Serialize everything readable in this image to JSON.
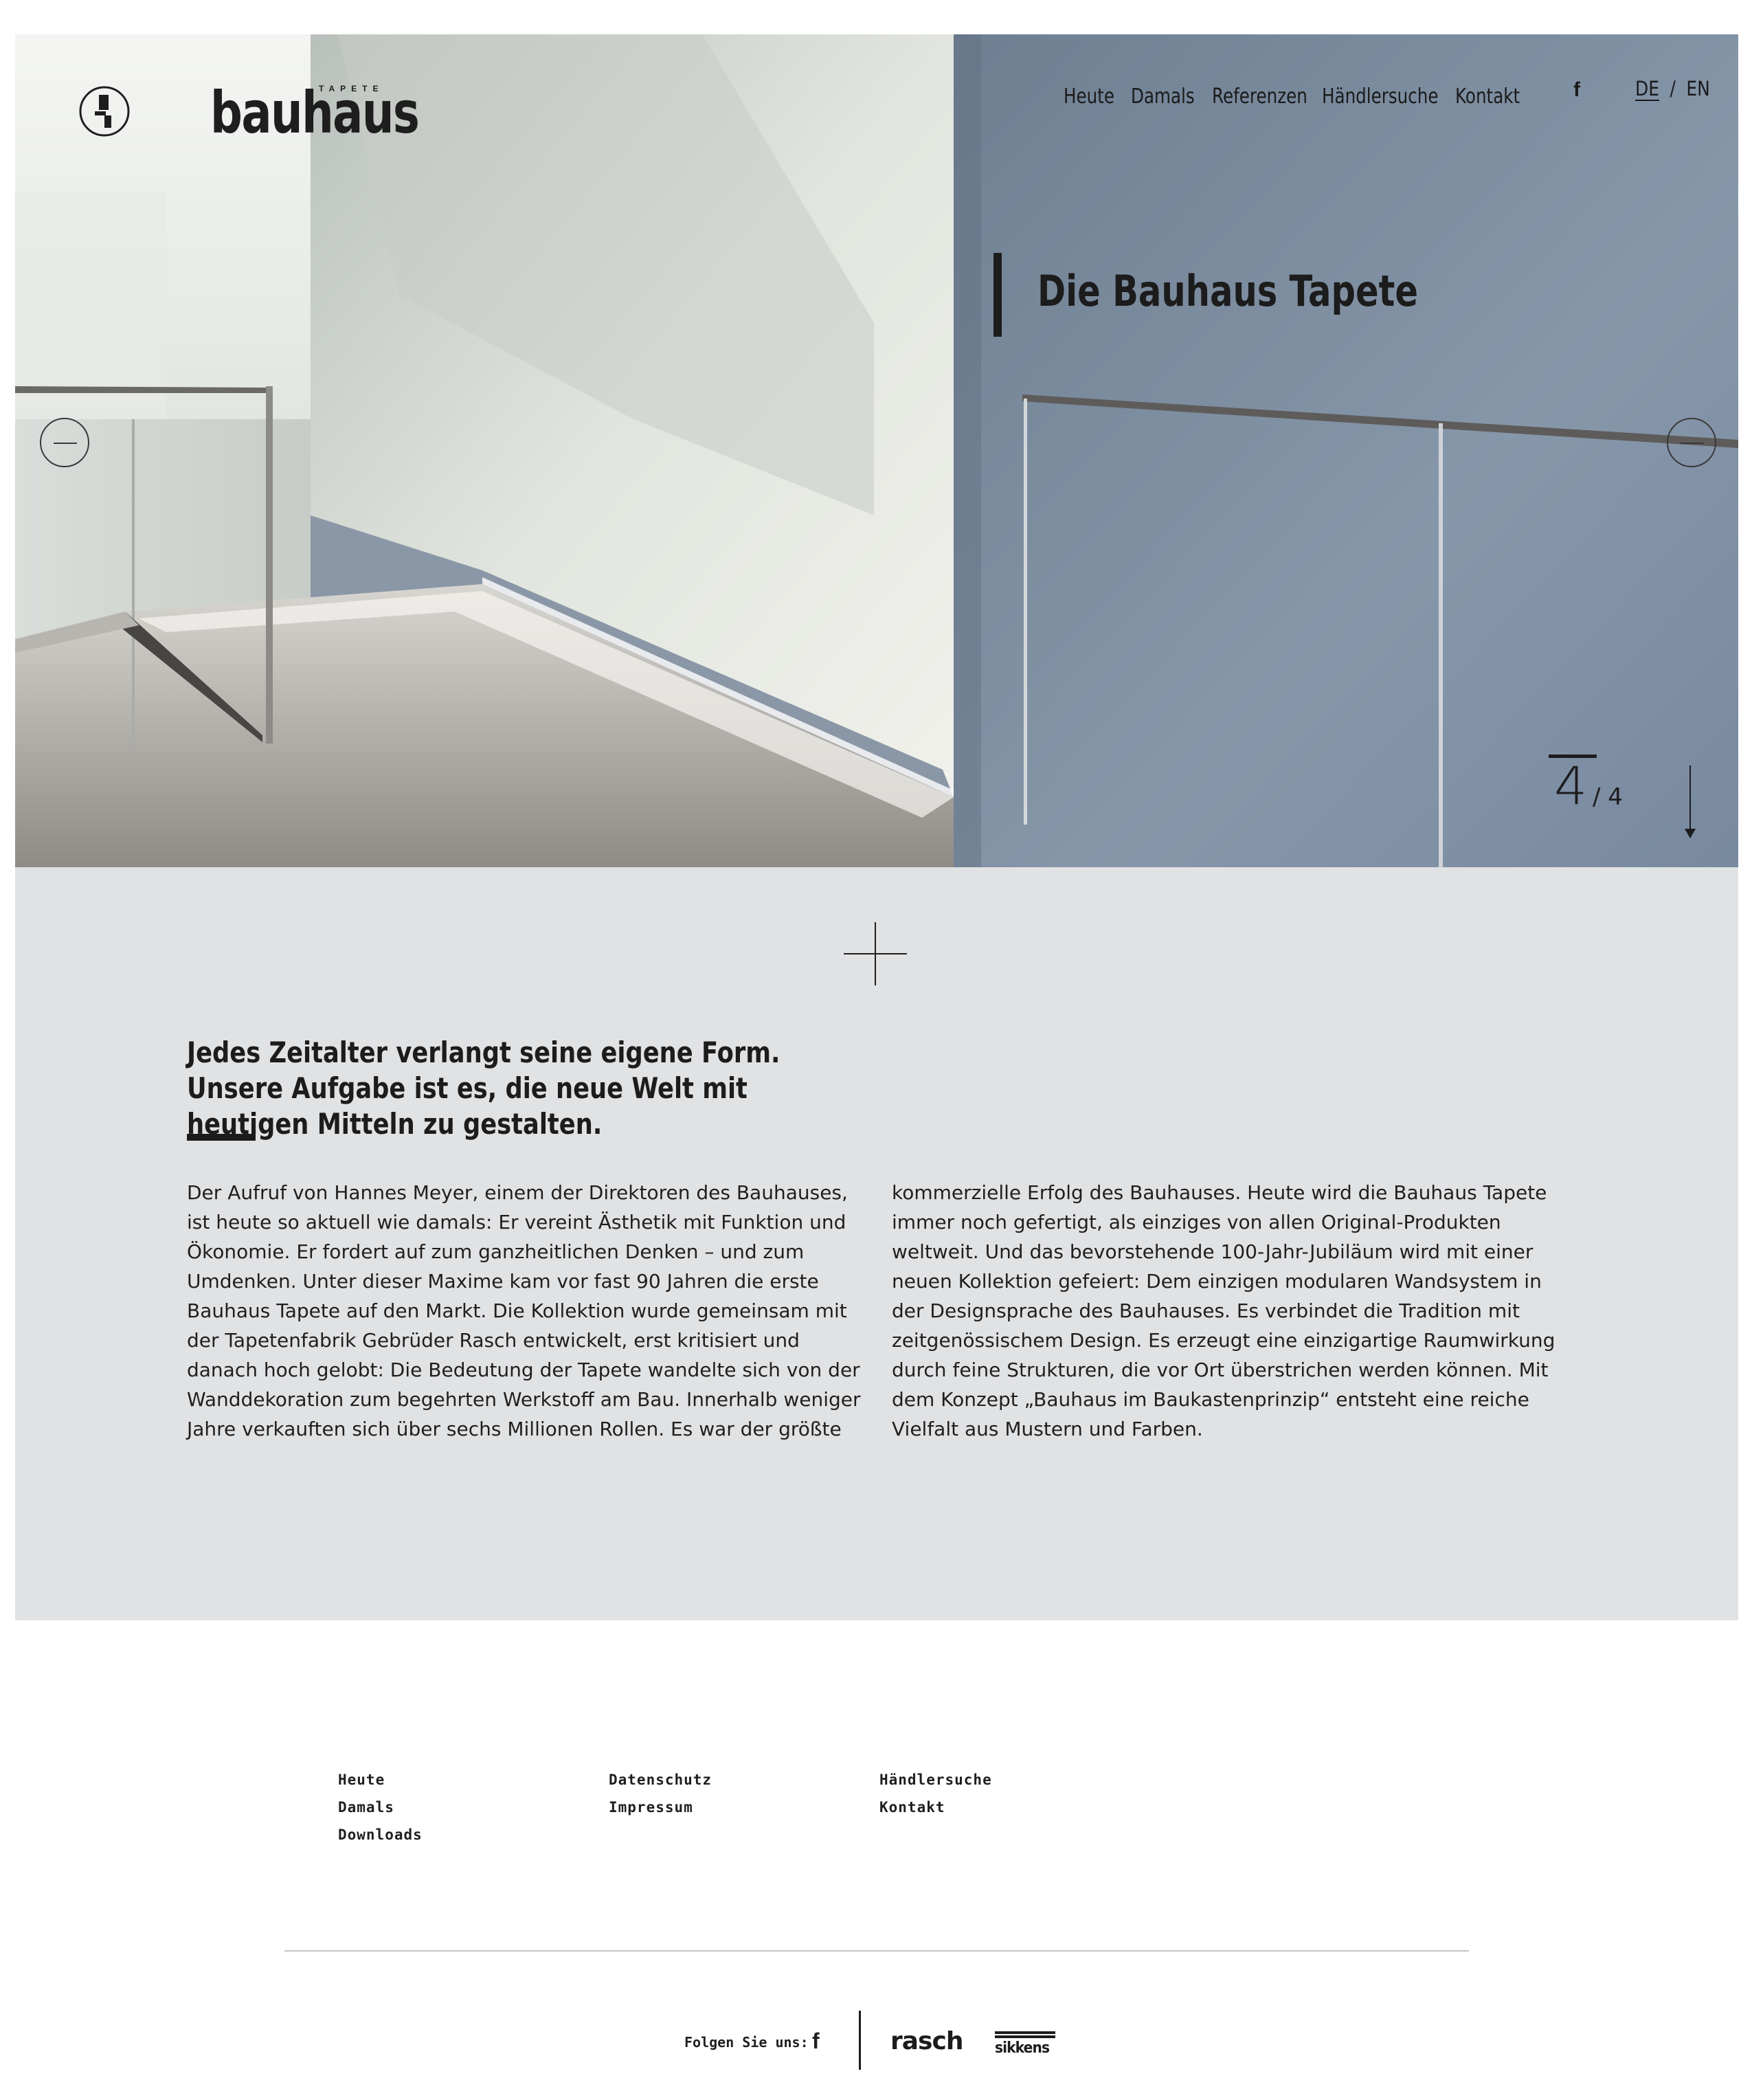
{
  "brand": {
    "wordmark": "bauhaus",
    "sub": "TAPETE"
  },
  "nav": {
    "items": [
      "Heute",
      "Damals",
      "Referenzen",
      "Händlersuche",
      "Kontakt"
    ],
    "social_icon": "facebook-icon",
    "lang_active": "DE",
    "lang_sep": "/",
    "lang_other": "EN"
  },
  "hero": {
    "title": "Die Bauhaus Tapete",
    "counter_current": "4",
    "counter_total": "/ 4",
    "prev_icon": "arrow-left-icon",
    "next_icon": "arrow-right-icon",
    "scroll_icon": "arrow-down-icon"
  },
  "intro": {
    "lead": "Jedes Zeitalter verlangt seine eigene Form. Unsere Aufgabe ist es, die neue Welt mit heutigen Mitteln zu gestalten.",
    "col_left": "Der Aufruf von Hannes Meyer, einem der Direktoren des Bauhauses, ist heute so aktuell wie damals: Er vereint Ästhetik mit Funktion und Ökonomie. Er fordert auf zum ganzheitlichen Denken – und zum Umdenken. Unter dieser Maxime kam vor fast 90 Jahren die erste Bauhaus Tapete auf den Markt. Die Kollektion wurde gemeinsam mit der Tapetenfabrik Gebrüder Rasch entwickelt, erst kritisiert und danach hoch gelobt: Die Bedeutung der Tapete wandelte sich von der Wanddekoration zum begehrten Werkstoff am Bau. Innerhalb weniger Jahre verkauften sich über sechs Millionen Rollen. Es war der größte",
    "col_right": "kommerzielle Erfolg des Bauhauses. Heute wird die Bauhaus Tapete immer noch gefertigt, als einziges von allen Original-Produkten weltweit. Und das bevorstehende 100-Jahr-Jubiläum wird mit einer neuen Kollektion gefeiert: Dem einzigen modularen Wandsystem in der Designsprache des Bauhauses. Es verbindet die Tradition mit zeitgenössischem Design. Es erzeugt eine einzigartige Raumwirkung durch feine Strukturen, die vor Ort überstrichen werden können. Mit dem Konzept „Bauhaus im Baukastenprinzip“ entsteht eine reiche Vielfalt aus Mustern und Farben.",
    "cross_icon": "plus-icon"
  },
  "footer": {
    "col1": [
      "Heute",
      "Damals",
      "Downloads"
    ],
    "col2": [
      "Datenschutz",
      "Impressum"
    ],
    "col3": [
      "Händlersuche",
      "Kontakt"
    ],
    "follow_label": "Folgen Sie uns:",
    "social_icon": "facebook-icon",
    "partner1": "rasch",
    "partner2": "sikkens"
  },
  "colors": {
    "intro_bg": "#e1e2e4",
    "text": "#1c1c1c",
    "wall_blue": "#7e8da0"
  }
}
